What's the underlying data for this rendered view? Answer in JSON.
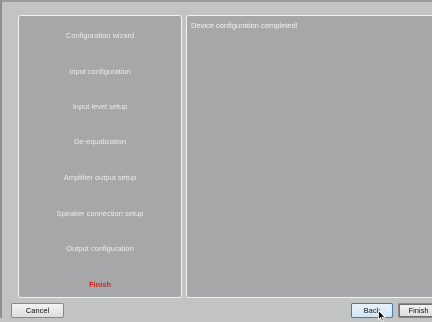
{
  "wizard": {
    "steps": [
      {
        "label": "Configuration wizard"
      },
      {
        "label": "Input configuration"
      },
      {
        "label": "Input level setup"
      },
      {
        "label": "De-equalization"
      },
      {
        "label": "Amplifier output setup"
      },
      {
        "label": "Speaker connection setup"
      },
      {
        "label": "Output configuration"
      },
      {
        "label": "Finish"
      }
    ],
    "active_step": "Finish",
    "active_color": "#e01b12"
  },
  "content": {
    "status": "Device configuration completed!"
  },
  "buttons": {
    "cancel": "Cancel",
    "back": "Back",
    "finish": "Finish"
  },
  "icons": {
    "cursor": "mouse-pointer-icon"
  }
}
